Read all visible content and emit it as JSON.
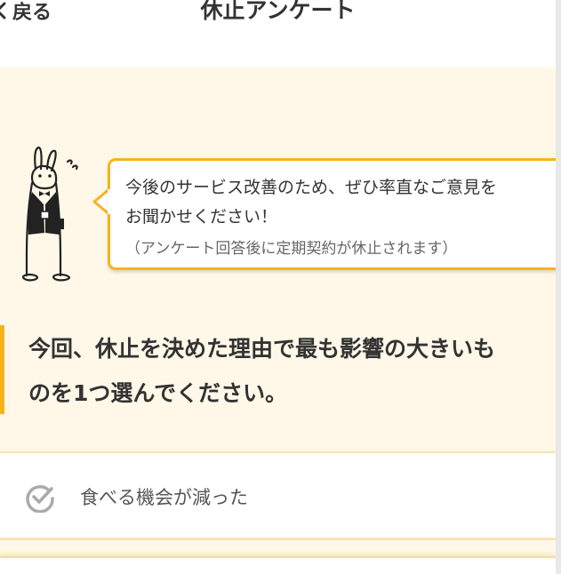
{
  "header": {
    "back_label": "戻る",
    "title": "休止アンケート"
  },
  "bubble": {
    "line1": "今後のサービス改善のため、ぜひ率直なご意見を",
    "line2": "お聞かせください！",
    "note": "（アンケート回答後に定期契約が休止されます）"
  },
  "question": {
    "line1": "今回、休止を決めた理由で最も影響の大きいも",
    "line2": "のを1つ選んでください。"
  },
  "options": [
    {
      "label": "食べる機会が減った",
      "icon": "check-circle-icon"
    }
  ],
  "colors": {
    "accent": "#f6b41c",
    "background": "#fff8e8",
    "option_border": "#f7e3b6"
  }
}
